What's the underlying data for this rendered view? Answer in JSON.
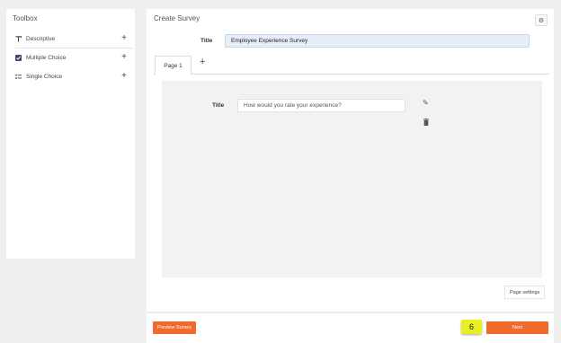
{
  "toolbox": {
    "title": "Toolbox",
    "items": [
      {
        "label": "Descriptive",
        "icon": "text-icon",
        "add": "+"
      },
      {
        "label": "Multiple Choice",
        "icon": "checkbox-icon",
        "add": "+"
      },
      {
        "label": "Single Choice",
        "icon": "list-icon",
        "add": "+"
      }
    ]
  },
  "editor": {
    "title": "Create Survey",
    "settings_icon": "gear-icon",
    "survey_title_label": "Title",
    "survey_title_value": "Employee Experience Survey",
    "tabs": [
      {
        "label": "Page 1",
        "active": true
      }
    ],
    "add_tab": "+",
    "question": {
      "label": "Title",
      "value": "How would you rate your experience?",
      "edit_icon": "pencil-icon",
      "delete_icon": "trash-icon"
    },
    "page_settings_label": "Page settings"
  },
  "footer": {
    "preview_label": "Preview Survey",
    "step_badge": "6",
    "next_label": "Next"
  },
  "colors": {
    "accent": "#f06a2b",
    "badge": "#e6f022",
    "title_input_bg": "#e8eef8"
  }
}
